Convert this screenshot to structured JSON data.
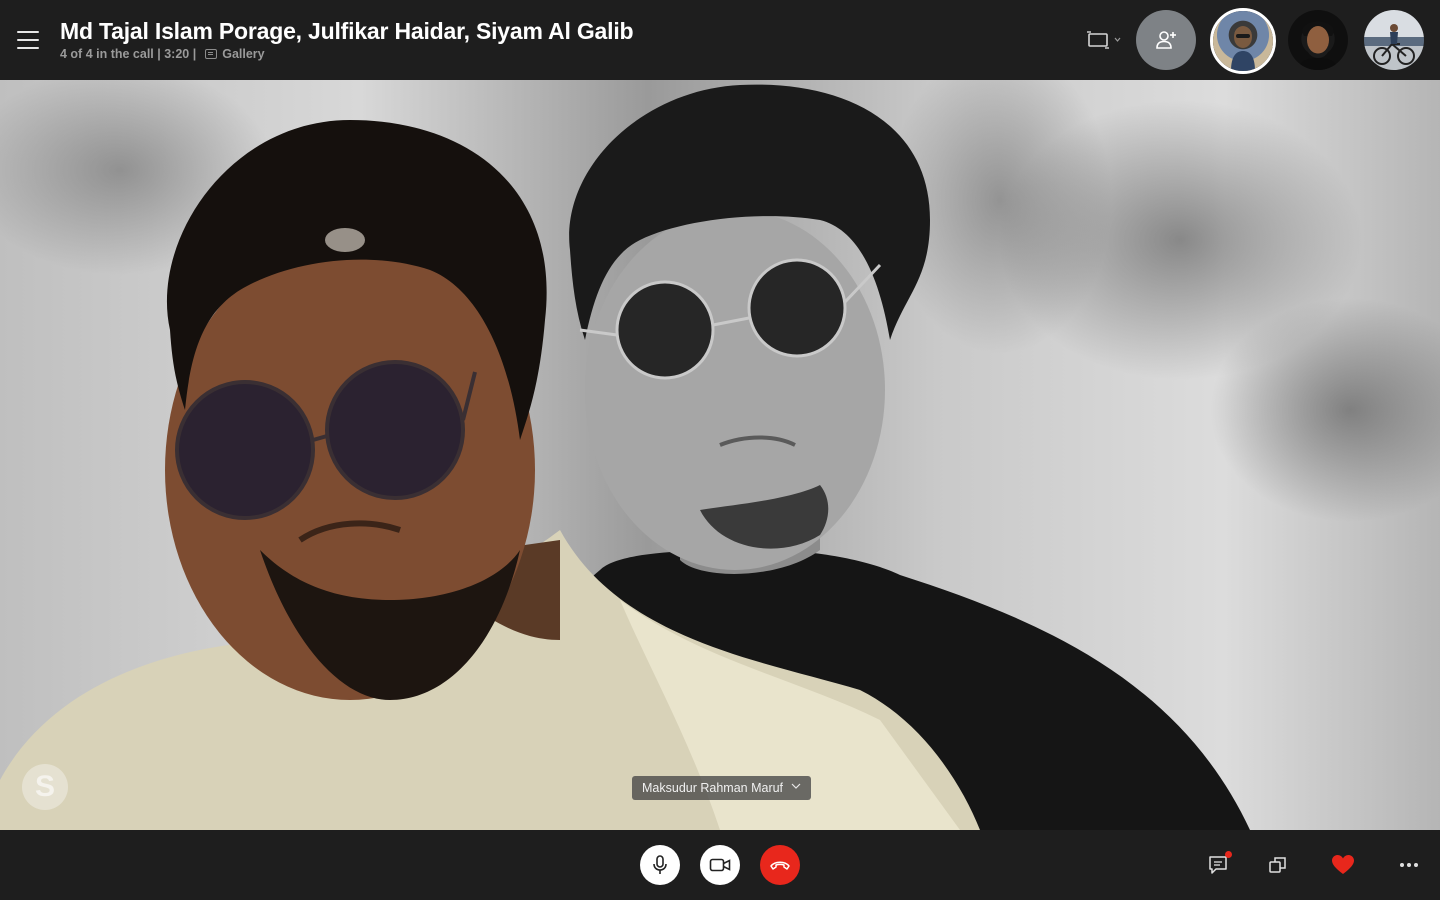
{
  "call": {
    "title": "Md Tajal Islam Porage, Julfikar Haidar, Siyam Al Galib",
    "participants_status": "4 of 4 in the call | 3:20 |",
    "view_mode": "Gallery"
  },
  "participants": [
    {
      "avatar": "participant-avatar-1",
      "active": true
    },
    {
      "avatar": "participant-avatar-2",
      "active": false
    },
    {
      "avatar": "participant-avatar-3",
      "active": false
    }
  ],
  "stage": {
    "speaker_name": "Maksudur Rahman Maruf",
    "watermark": "S"
  },
  "controls": {
    "mic": "microphone-icon",
    "camera": "video-camera-icon",
    "end_call": "hang-up-icon",
    "chat": "chat-icon",
    "switch": "switch-camera-icon",
    "reaction": "heart-icon",
    "more": "more-icon"
  },
  "colors": {
    "bar_bg": "#1e1e1e",
    "end_call_red": "#e8271c",
    "heart_red": "#e8271c",
    "add_person_grey": "#7e8286",
    "subtitle_grey": "#9a9a9a"
  }
}
